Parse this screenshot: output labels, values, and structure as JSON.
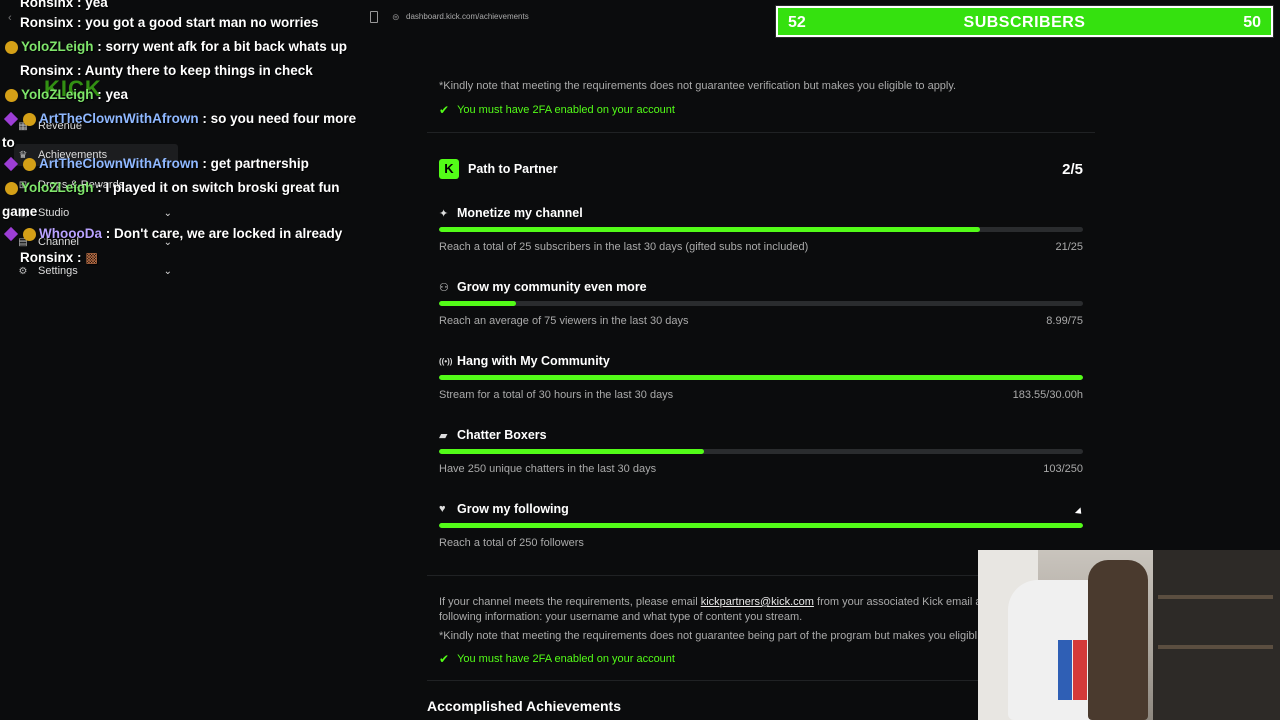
{
  "browser": {
    "url": "dashboard.kick.com/achievements"
  },
  "sub_goal": {
    "current": "52",
    "label": "SUBSCRIBERS",
    "goal": "50"
  },
  "sidebar": {
    "logo": "KICK",
    "items": [
      {
        "label": "Revenue",
        "icon": "revenue-icon"
      },
      {
        "label": "Achievements",
        "icon": "trophy-icon"
      },
      {
        "label": "Drops & Rewards",
        "icon": "gift-icon"
      },
      {
        "label": "Studio",
        "icon": "studio-icon"
      },
      {
        "label": "Channel",
        "icon": "channel-icon"
      },
      {
        "label": "Settings",
        "icon": "gear-icon"
      }
    ]
  },
  "chat": [
    {
      "user": "Ronsinx",
      "text": "yea",
      "color": "#ffffff"
    },
    {
      "user": "Ronsinx",
      "text": "you got a good start man no worries",
      "color": "#ffffff"
    },
    {
      "user": "YoloZLeigh",
      "text": "sorry went afk for a bit back whats up",
      "color": "#7fe56b"
    },
    {
      "user": "Ronsinx",
      "text": "Aunty there to keep things in check",
      "color": "#ffffff"
    },
    {
      "user": "YoloZLeigh",
      "text": "yea",
      "color": "#7fe56b"
    },
    {
      "user": "ArtTheClownWithAfrown",
      "text": "so you need four more to",
      "color": "#8fb8ff"
    },
    {
      "user": "ArtTheClownWithAfrown",
      "text": "get partnership",
      "color": "#8fb8ff"
    },
    {
      "user": "YoloZLeigh",
      "text": "I played it on switch broski great fun game",
      "color": "#7fe56b"
    },
    {
      "user": "WhoooDa",
      "text": "Don't care, we are locked in already",
      "color": "#b9a2ff"
    },
    {
      "user": "Ronsinx",
      "text": "",
      "color": "#ffffff"
    }
  ],
  "verification": {
    "note": "*Kindly note that meeting the requirements does not guarantee verification but makes you eligible to apply.",
    "requirement": "You must have 2FA enabled on your account"
  },
  "path_to_partner": {
    "title": "Path to Partner",
    "progress": "2/5",
    "goals": [
      {
        "title": "Monetize my channel",
        "icon": "sparkle-icon",
        "description": "Reach a total of 25 subscribers in the last 30 days (gifted subs not included)",
        "value": "21/25",
        "fraction": 0.84
      },
      {
        "title": "Grow my community even more",
        "icon": "users-icon",
        "description": "Reach an average of 75 viewers in the last 30 days",
        "value": "8.99/75",
        "fraction": 0.12
      },
      {
        "title": "Hang with My Community",
        "icon": "broadcast-icon",
        "description": "Stream for a total of 30 hours in the last 30 days",
        "value": "183.55/30.00h",
        "fraction": 1.0
      },
      {
        "title": "Chatter Boxers",
        "icon": "chat-icon",
        "description": "Have 250 unique chatters in the last 30 days",
        "value": "103/250",
        "fraction": 0.412
      },
      {
        "title": "Grow my following",
        "icon": "heart-icon",
        "description": "Reach a total of 250 followers",
        "value": "",
        "fraction": 1.0
      }
    ],
    "email_text_pre": "If your channel meets the requirements, please email",
    "email": "kickpartners@kick.com",
    "email_text_post": "from your associated Kick email a",
    "email_text_line2": "following information: your username and what type of content you stream.",
    "note": "*Kindly note that meeting the requirements does not guarantee being part of the program but makes you eligibl",
    "requirement": "You must have 2FA enabled on your account"
  },
  "accomplished": {
    "title": "Accomplished Achievements"
  },
  "colors": {
    "accent": "#53fc18",
    "background": "#0b0c0d",
    "muted_text": "#aaaaaa"
  }
}
